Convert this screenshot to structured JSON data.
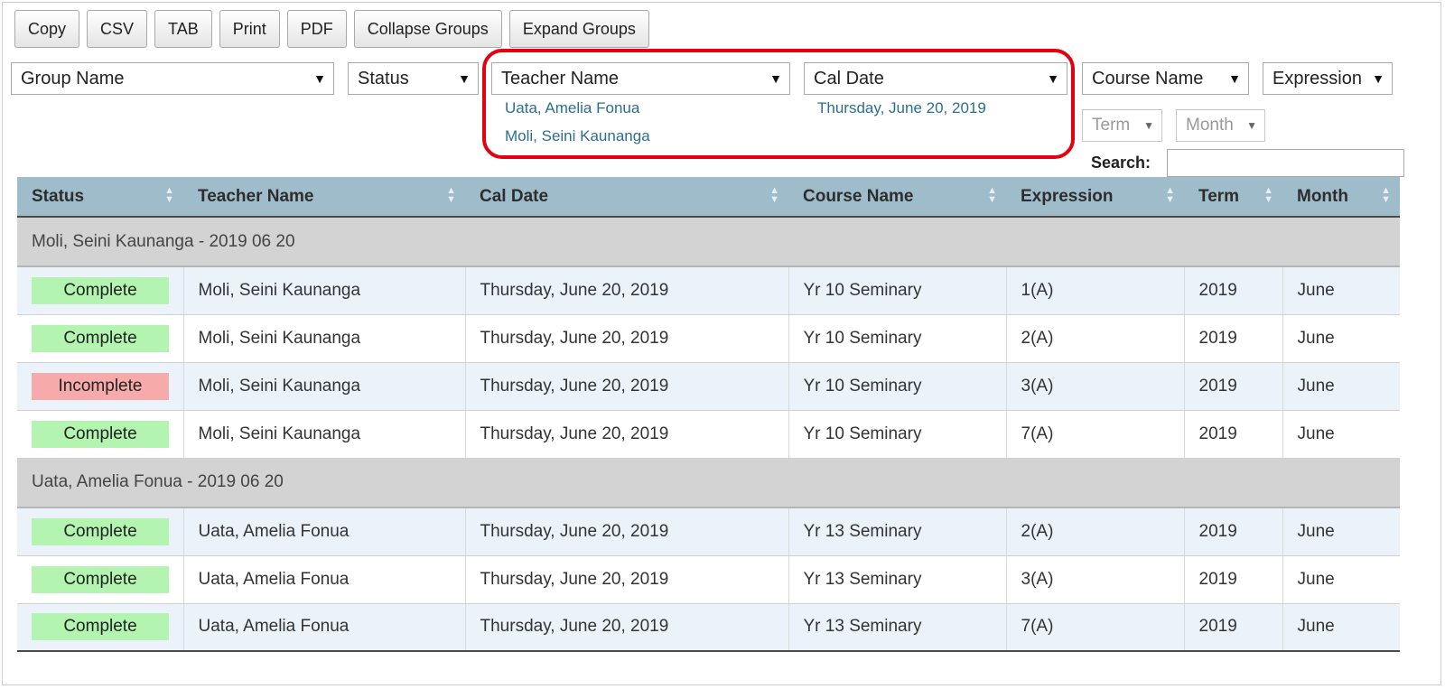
{
  "toolbar": {
    "buttons": [
      "Copy",
      "CSV",
      "TAB",
      "Print",
      "PDF",
      "Collapse Groups",
      "Expand Groups"
    ]
  },
  "filters": {
    "group_name": "Group Name",
    "status": "Status",
    "teacher_name": "Teacher Name",
    "cal_date": "Cal Date",
    "course_name": "Course Name",
    "expression": "Expression",
    "term": "Term",
    "month": "Month",
    "teacher_selected": [
      "Uata, Amelia Fonua",
      "Moli, Seini Kaunanga"
    ],
    "cal_date_selected": [
      "Thursday, June 20, 2019"
    ]
  },
  "search": {
    "label": "Search:",
    "value": ""
  },
  "table": {
    "columns": [
      "Status",
      "Teacher Name",
      "Cal Date",
      "Course Name",
      "Expression",
      "Term",
      "Month"
    ],
    "groups": [
      {
        "title": "Moli, Seini Kaunanga - 2019 06 20",
        "rows": [
          {
            "status": "Complete",
            "teacher": "Moli, Seini Kaunanga",
            "date": "Thursday, June 20, 2019",
            "course": "Yr 10 Seminary",
            "expression": "1(A)",
            "term": "2019",
            "month": "June"
          },
          {
            "status": "Complete",
            "teacher": "Moli, Seini Kaunanga",
            "date": "Thursday, June 20, 2019",
            "course": "Yr 10 Seminary",
            "expression": "2(A)",
            "term": "2019",
            "month": "June"
          },
          {
            "status": "Incomplete",
            "teacher": "Moli, Seini Kaunanga",
            "date": "Thursday, June 20, 2019",
            "course": "Yr 10 Seminary",
            "expression": "3(A)",
            "term": "2019",
            "month": "June"
          },
          {
            "status": "Complete",
            "teacher": "Moli, Seini Kaunanga",
            "date": "Thursday, June 20, 2019",
            "course": "Yr 10 Seminary",
            "expression": "7(A)",
            "term": "2019",
            "month": "June"
          }
        ]
      },
      {
        "title": "Uata, Amelia Fonua - 2019 06 20",
        "rows": [
          {
            "status": "Complete",
            "teacher": "Uata, Amelia Fonua",
            "date": "Thursday, June 20, 2019",
            "course": "Yr 13 Seminary",
            "expression": "2(A)",
            "term": "2019",
            "month": "June"
          },
          {
            "status": "Complete",
            "teacher": "Uata, Amelia Fonua",
            "date": "Thursday, June 20, 2019",
            "course": "Yr 13 Seminary",
            "expression": "3(A)",
            "term": "2019",
            "month": "June"
          },
          {
            "status": "Complete",
            "teacher": "Uata, Amelia Fonua",
            "date": "Thursday, June 20, 2019",
            "course": "Yr 13 Seminary",
            "expression": "7(A)",
            "term": "2019",
            "month": "June"
          }
        ]
      }
    ]
  },
  "colors": {
    "header_bg": "#9fbcca",
    "complete": "#b3f5b0",
    "incomplete": "#f6aaaa",
    "highlight": "#e3000f",
    "link": "#2c6e8f"
  }
}
